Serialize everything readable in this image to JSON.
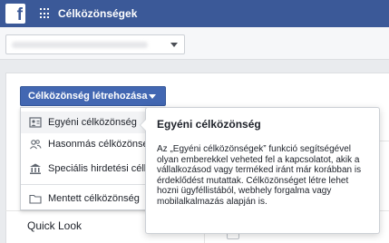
{
  "topbar": {
    "logo_letter": "f",
    "app_title": "Célközönségek"
  },
  "account": {
    "selected_value": ""
  },
  "toolbar": {
    "create_label": "Célközönség létrehozása"
  },
  "menu": {
    "items": [
      {
        "label": "Egyéni célközönség",
        "icon": "custom-audience-icon"
      },
      {
        "label": "Hasonmás célközönség",
        "icon": "people-icon"
      },
      {
        "label": "Speciális hirdetési célközönség",
        "icon": "institution-icon"
      },
      {
        "label": "Mentett célközönség",
        "icon": "folder-icon"
      }
    ]
  },
  "tooltip": {
    "title": "Egyéni célközönség",
    "body": "Az „Egyéni célközönségek” funkció segítségével olyan emberekkel veheted fel a kapcsolatot, akik a vállalkozásod vagy terméked iránt már korábban is érdeklődést mutattak. Célközönséget létre lehet hozni ügyféllistából, webhely forgalma vagy mobilalkalmazás alapján is."
  },
  "table": {
    "row_label": "Quick Look"
  },
  "colors": {
    "brand": "#3b5998",
    "button": "#4267b2"
  }
}
